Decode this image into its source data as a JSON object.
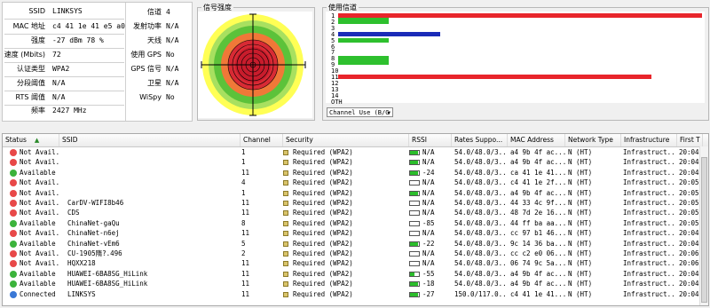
{
  "info_panel": {
    "rows": [
      {
        "label": "SSID",
        "value": "LINKSYS"
      },
      {
        "label": "MAC 地址",
        "value": "c4 41 1e 41 e5 a0"
      },
      {
        "label": "强度",
        "value": "-27 dBm    78 %"
      },
      {
        "label": "速度 (Mbits)",
        "value": "72"
      },
      {
        "label": "认证类型",
        "value": "WPA2"
      },
      {
        "label": "分段阈值",
        "value": "N/A"
      },
      {
        "label": "RTS 阈值",
        "value": "N/A"
      },
      {
        "label": "频率",
        "value": "2427 MHz"
      }
    ],
    "rows2": [
      {
        "label": "信道",
        "value": "4"
      },
      {
        "label": "发射功率",
        "value": "N/A"
      },
      {
        "label": "天线",
        "value": "N/A"
      },
      {
        "label": "使用 GPS",
        "value": "No"
      },
      {
        "label": "GPS 信号",
        "value": "N/A"
      },
      {
        "label": "卫星",
        "value": "N/A"
      },
      {
        "label": "WiSpy",
        "value": "No"
      }
    ]
  },
  "signal_panel": {
    "title": "信号强度"
  },
  "channel_panel": {
    "title": "使用信道",
    "channels": [
      "1",
      "2",
      "3",
      "4",
      "5",
      "6",
      "7",
      "8",
      "9",
      "10",
      "11",
      "12",
      "13",
      "14",
      "OTH"
    ],
    "bars": [
      {
        "channel": "1",
        "fraction": 1.0,
        "color": "#e8252b"
      },
      {
        "channel": "1",
        "fraction": 0.14,
        "color": "#2ec02e"
      },
      {
        "channel": "2",
        "fraction": 0.14,
        "color": "#2ec02e"
      },
      {
        "channel": "4",
        "fraction": 0.28,
        "color": "#1a2bb8"
      },
      {
        "channel": "5",
        "fraction": 0.14,
        "color": "#2ec02e"
      },
      {
        "channel": "8",
        "fraction": 0.14,
        "color": "#2ec02e"
      },
      {
        "channel": "8",
        "fraction": 0.14,
        "color": "#2ec02e"
      },
      {
        "channel": "11",
        "fraction": 0.86,
        "color": "#e8252b"
      }
    ],
    "select_value": "Channel Use (B/G"
  },
  "table": {
    "columns": [
      "Status",
      "SSID",
      "Channel",
      "Security",
      "RSSI",
      "Rates Suppo...",
      "MAC Address",
      "Network Type",
      "Infrastructure",
      "First T"
    ],
    "rows": [
      {
        "status": "Not Avail...",
        "ssid": "",
        "channel": "1",
        "security": "Required (WPA2)",
        "rssi": "N/A",
        "rates": "54.0/48.0/3...",
        "mac": "a4 9b 4f ac...",
        "nettype": "N (HT)",
        "infra": "Infrastruct...",
        "first": "20:04:5",
        "dot": "#e84848",
        "rssi_level": 0.9
      },
      {
        "status": "Not Avail...",
        "ssid": "",
        "channel": "1",
        "security": "Required (WPA2)",
        "rssi": "N/A",
        "rates": "54.0/48.0/3...",
        "mac": "a4 9b 4f ac...",
        "nettype": "N (HT)",
        "infra": "Infrastruct...",
        "first": "20:04:5",
        "dot": "#e84848",
        "rssi_level": 0.9
      },
      {
        "status": "Available",
        "ssid": "",
        "channel": "11",
        "security": "Required (WPA2)",
        "rssi": "-24",
        "rates": "54.0/48.0/3...",
        "mac": "ca 41 1e 41...",
        "nettype": "N (HT)",
        "infra": "Infrastruct...",
        "first": "20:04:5",
        "dot": "#3bb33b",
        "rssi_level": 0.9
      },
      {
        "status": "Not Avail...",
        "ssid": "",
        "channel": "4",
        "security": "Required (WPA2)",
        "rssi": "N/A",
        "rates": "54.0/48.0/3...",
        "mac": "c4 41 1e 2f...",
        "nettype": "N (HT)",
        "infra": "Infrastruct...",
        "first": "20:05:0",
        "dot": "#e84848",
        "rssi_level": 0.0
      },
      {
        "status": "Not Avail...",
        "ssid": "",
        "channel": "1",
        "security": "Required (WPA2)",
        "rssi": "N/A",
        "rates": "54.0/48.0/3...",
        "mac": "a4 9b 4f ac...",
        "nettype": "N (HT)",
        "infra": "Infrastruct...",
        "first": "20:05:0",
        "dot": "#e84848",
        "rssi_level": 0.9
      },
      {
        "status": "Not Avail...",
        "ssid": "CarDV-WIFI8b46",
        "channel": "11",
        "security": "Required (WPA2)",
        "rssi": "N/A",
        "rates": "54.0/48.0/3...",
        "mac": "44 33 4c 9f...",
        "nettype": "N (HT)",
        "infra": "Infrastruct...",
        "first": "20:05:1",
        "dot": "#e84848",
        "rssi_level": 0.0
      },
      {
        "status": "Not Avail...",
        "ssid": "CDS",
        "channel": "11",
        "security": "Required (WPA2)",
        "rssi": "N/A",
        "rates": "54.0/48.0/3...",
        "mac": "48 7d 2e 16...",
        "nettype": "N (HT)",
        "infra": "Infrastruct...",
        "first": "20:05:2",
        "dot": "#e84848",
        "rssi_level": 0.0
      },
      {
        "status": "Available",
        "ssid": "ChinaNet-gaQu",
        "channel": "8",
        "security": "Required (WPA2)",
        "rssi": "-85",
        "rates": "54.0/48.0/3...",
        "mac": "44 ff ba aa...",
        "nettype": "N (HT)",
        "infra": "Infrastruct...",
        "first": "20:05:3",
        "dot": "#3bb33b",
        "rssi_level": 0.0
      },
      {
        "status": "Not Avail...",
        "ssid": "ChinaNet-n6ej",
        "channel": "11",
        "security": "Required (WPA2)",
        "rssi": "N/A",
        "rates": "54.0/48.0/3...",
        "mac": "cc 97 b1 46...",
        "nettype": "N (HT)",
        "infra": "Infrastruct...",
        "first": "20:04:5",
        "dot": "#e84848",
        "rssi_level": 0.0
      },
      {
        "status": "Available",
        "ssid": "ChinaNet-vEm6",
        "channel": "5",
        "security": "Required (WPA2)",
        "rssi": "-22",
        "rates": "54.0/48.0/3...",
        "mac": "9c 14 36 ba...",
        "nettype": "N (HT)",
        "infra": "Infrastruct...",
        "first": "20:04:5",
        "dot": "#3bb33b",
        "rssi_level": 0.9
      },
      {
        "status": "Not Avail...",
        "ssid": "CU-1905隋?.496",
        "channel": "2",
        "security": "Required (WPA2)",
        "rssi": "N/A",
        "rates": "54.0/48.0/3...",
        "mac": "cc c2 e0 06...",
        "nettype": "N (HT)",
        "infra": "Infrastruct...",
        "first": "20:06:0",
        "dot": "#e84848",
        "rssi_level": 0.0
      },
      {
        "status": "Not Avail...",
        "ssid": "HQXX218",
        "channel": "11",
        "security": "Required (WPA2)",
        "rssi": "N/A",
        "rates": "54.0/48.0/3...",
        "mac": "06 74 9c 5a...",
        "nettype": "N (HT)",
        "infra": "Infrastruct...",
        "first": "20:06:1",
        "dot": "#e84848",
        "rssi_level": 0.0
      },
      {
        "status": "Available",
        "ssid": "HUAWEI-6BA8SG_HiLink",
        "channel": "11",
        "security": "Required (WPA2)",
        "rssi": "-55",
        "rates": "54.0/48.0/3...",
        "mac": "a4 9b 4f ac...",
        "nettype": "N (HT)",
        "infra": "Infrastruct...",
        "first": "20:04:5",
        "dot": "#3bb33b",
        "rssi_level": 0.5
      },
      {
        "status": "Available",
        "ssid": "HUAWEI-6BA8SG_HiLink",
        "channel": "11",
        "security": "Required (WPA2)",
        "rssi": "-18",
        "rates": "54.0/48.0/3...",
        "mac": "a4 9b 4f ac...",
        "nettype": "N (HT)",
        "infra": "Infrastruct...",
        "first": "20:04:5",
        "dot": "#3bb33b",
        "rssi_level": 0.9
      },
      {
        "status": "Connected",
        "ssid": "LINKSYS",
        "channel": "11",
        "security": "Required (WPA2)",
        "rssi": "-27",
        "rates": "150.0/117.0...",
        "mac": "c4 41 1e 41...",
        "nettype": "N (HT)",
        "infra": "Infrastruct...",
        "first": "20:04:5",
        "dot": "#3a78d6",
        "rssi_level": 0.9
      }
    ]
  }
}
